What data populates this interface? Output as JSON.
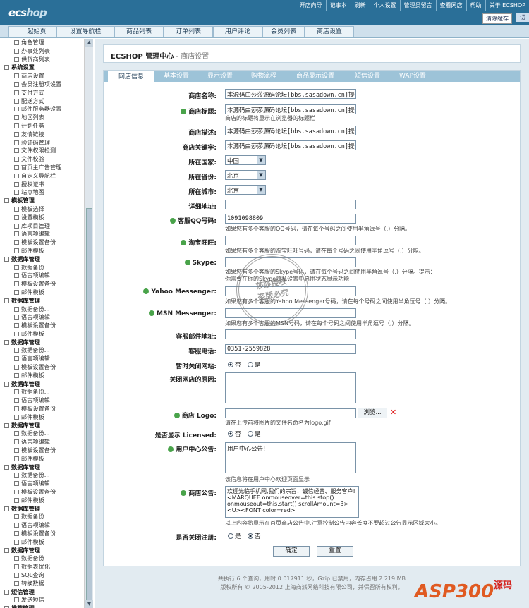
{
  "header": {
    "logo_main": "ecs",
    "logo_accent": "hop",
    "links": [
      "开店向导",
      "记事本",
      "刷新",
      "个人设置",
      "管理员留言",
      "查看网店",
      "帮助",
      "关于 ECSHOP"
    ],
    "clear_cache": "清除缓存",
    "lang": "切"
  },
  "nav": [
    "起始页",
    "设置导航栏",
    "商品列表",
    "订单列表",
    "用户评论",
    "会员列表",
    "商店设置"
  ],
  "sidebar": [
    {
      "t": "s",
      "label": "角色管理"
    },
    {
      "t": "s",
      "label": "办事处列表"
    },
    {
      "t": "s",
      "label": "供货商列表"
    },
    {
      "t": "h",
      "label": "系统设置"
    },
    {
      "t": "s",
      "label": "商店设置"
    },
    {
      "t": "s",
      "label": "会员注册项设置"
    },
    {
      "t": "s",
      "label": "支付方式"
    },
    {
      "t": "s",
      "label": "配送方式"
    },
    {
      "t": "s",
      "label": "邮件服务器设置"
    },
    {
      "t": "s",
      "label": "地区列表"
    },
    {
      "t": "s",
      "label": "计划任务"
    },
    {
      "t": "s",
      "label": "友情链接"
    },
    {
      "t": "s",
      "label": "验证码管理"
    },
    {
      "t": "s",
      "label": "文件权限检测"
    },
    {
      "t": "s",
      "label": "文件校验"
    },
    {
      "t": "s",
      "label": "首页主广告管理"
    },
    {
      "t": "s",
      "label": "自定义导航栏"
    },
    {
      "t": "s",
      "label": "授权证书"
    },
    {
      "t": "s",
      "label": "站点地图"
    },
    {
      "t": "h",
      "label": "模板管理"
    },
    {
      "t": "s",
      "label": "模板选择"
    },
    {
      "t": "s",
      "label": "设置模板"
    },
    {
      "t": "s",
      "label": "库项目管理"
    },
    {
      "t": "s",
      "label": "语言项编辑"
    },
    {
      "t": "s",
      "label": "模板设置备份"
    },
    {
      "t": "s",
      "label": "邮件模板"
    },
    {
      "t": "h",
      "label": "数据库管理"
    },
    {
      "t": "s",
      "label": "数据备份..."
    },
    {
      "t": "s",
      "label": "语言项编辑"
    },
    {
      "t": "s",
      "label": "模板设置备份"
    },
    {
      "t": "s",
      "label": "邮件模板"
    },
    {
      "t": "h",
      "label": "数据库管理"
    },
    {
      "t": "s",
      "label": "数据备份..."
    },
    {
      "t": "s",
      "label": "语言项编辑"
    },
    {
      "t": "s",
      "label": "模板设置备份"
    },
    {
      "t": "s",
      "label": "邮件模板"
    },
    {
      "t": "h",
      "label": "数据库管理"
    },
    {
      "t": "s",
      "label": "数据备份..."
    },
    {
      "t": "s",
      "label": "语言项编辑"
    },
    {
      "t": "s",
      "label": "模板设置备份"
    },
    {
      "t": "s",
      "label": "邮件模板"
    },
    {
      "t": "h",
      "label": "数据库管理"
    },
    {
      "t": "s",
      "label": "数据备份..."
    },
    {
      "t": "s",
      "label": "语言项编辑"
    },
    {
      "t": "s",
      "label": "模板设置备份"
    },
    {
      "t": "s",
      "label": "邮件模板"
    },
    {
      "t": "h",
      "label": "数据库管理"
    },
    {
      "t": "s",
      "label": "数据备份..."
    },
    {
      "t": "s",
      "label": "语言项编辑"
    },
    {
      "t": "s",
      "label": "模板设置备份"
    },
    {
      "t": "s",
      "label": "邮件模板"
    },
    {
      "t": "h",
      "label": "数据库管理"
    },
    {
      "t": "s",
      "label": "数据备份..."
    },
    {
      "t": "s",
      "label": "语言项编辑"
    },
    {
      "t": "s",
      "label": "模板设置备份"
    },
    {
      "t": "s",
      "label": "邮件模板"
    },
    {
      "t": "h",
      "label": "数据库管理"
    },
    {
      "t": "s",
      "label": "数据备份..."
    },
    {
      "t": "s",
      "label": "语言项编辑"
    },
    {
      "t": "s",
      "label": "模板设置备份"
    },
    {
      "t": "s",
      "label": "邮件模板"
    },
    {
      "t": "h",
      "label": "数据库管理"
    },
    {
      "t": "s",
      "label": "数据备份"
    },
    {
      "t": "s",
      "label": "数据表优化"
    },
    {
      "t": "s",
      "label": "SQL查询"
    },
    {
      "t": "s",
      "label": "转换数据"
    },
    {
      "t": "h",
      "label": "短信管理"
    },
    {
      "t": "s",
      "label": "发送短信"
    },
    {
      "t": "h",
      "label": "推荐管理"
    }
  ],
  "page": {
    "title": "ECSHOP 管理中心",
    "subtitle": " - 商店设置"
  },
  "tabs": [
    "网店信息",
    "基本设置",
    "显示设置",
    "购物流程",
    "商品显示设置",
    "短信设置",
    "WAP设置"
  ],
  "form": {
    "shop_name": {
      "label": "商店名称:",
      "value": "本源码由莎莎源码论坛[bbs.sasadown.cn]提供"
    },
    "shop_title": {
      "label": "商店标题:",
      "value": "本源码由莎莎源码论坛[bbs.sasadown.cn]提供",
      "hint": "商店的标题将显示在浏览器的标题栏"
    },
    "shop_desc": {
      "label": "商店描述:",
      "value": "本源码由莎莎源码论坛[bbs.sasadown.cn]提供"
    },
    "shop_keywords": {
      "label": "商店关键字:",
      "value": "本源码由莎莎源码论坛[bbs.sasadown.cn]提供"
    },
    "country": {
      "label": "所在国家:",
      "value": "中国"
    },
    "province": {
      "label": "所在省份:",
      "value": "北京"
    },
    "city": {
      "label": "所在城市:",
      "value": "北京"
    },
    "address": {
      "label": "详细地址:",
      "value": ""
    },
    "qq": {
      "label": "客服QQ号码:",
      "value": "1091098809",
      "hint": "如果您有多个客服的QQ号码，请在每个号码之间使用半角逗号（,）分隔。"
    },
    "ww": {
      "label": "淘宝旺旺:",
      "value": "",
      "hint": "如果您有多个客服的淘宝旺旺号码，请在每个号码之间使用半角逗号（,）分隔。"
    },
    "skype": {
      "label": "Skype:",
      "value": "",
      "hint": "如果您有多个客服的Skype号码，请在每个号码之间使用半角逗号（,）分隔。提示：你需要在你的Skype隐私设置中启用状态显示功能"
    },
    "yahoo": {
      "label": "Yahoo Messenger:",
      "value": "",
      "hint": "如果您有多个客服的Yahoo Messenger号码，请在每个号码之间使用半角逗号（,）分隔。"
    },
    "msn": {
      "label": "MSN Messenger:",
      "value": "",
      "hint": "如果您有多个客服的MSN号码，请在每个号码之间使用半角逗号（,）分隔。"
    },
    "email": {
      "label": "客服邮件地址:",
      "value": ""
    },
    "tel": {
      "label": "客服电话:",
      "value": "0351-2559828"
    },
    "closed": {
      "label": "暂时关闭网站:",
      "opt1": "否",
      "opt2": "是"
    },
    "close_reason": {
      "label": "关闭网店的原因:",
      "value": ""
    },
    "logo": {
      "label": "商店 Logo:",
      "browse": "浏览...",
      "delete": "✕",
      "hint": "请在上传前将图片的文件名命名为logo.gif"
    },
    "licensed": {
      "label": "是否显示 Licensed:",
      "opt1": "否",
      "opt2": "是"
    },
    "user_notice": {
      "label": "用户中心公告:",
      "value": "用户中心公告!",
      "hint": "该信息将在用户中心欢迎页面显示"
    },
    "shop_notice": {
      "label": "商店公告:",
      "value": "欢迎光临手机网,我们的宗旨：诚信经营、服务客户!\n<MARQUEE onmouseover=this.stop() onmouseout=this.start() scrollAmount=3><U><FONT color=red>",
      "hint": "以上内容将显示在首页商店公告中,注意控制公告内容长度不要超过公告显示区域大小。"
    },
    "close_register": {
      "label": "是否关闭注册:",
      "opt1": "是",
      "opt2": "否"
    },
    "submit": "确定",
    "reset": "重置"
  },
  "footer": {
    "line1": "共执行 6 个查询，用时 0.017911 秒，Gzip 已禁用，内存占用 2.219 MB",
    "line2": "版权所有 © 2005-2012 上海商派网络科技有限公司，并保留所有权利。"
  },
  "stamp": {
    "line1": "莎莎授权",
    "line2": "盗版必究"
  },
  "brand": {
    "logo": "ASP300",
    "tag": "源码"
  }
}
